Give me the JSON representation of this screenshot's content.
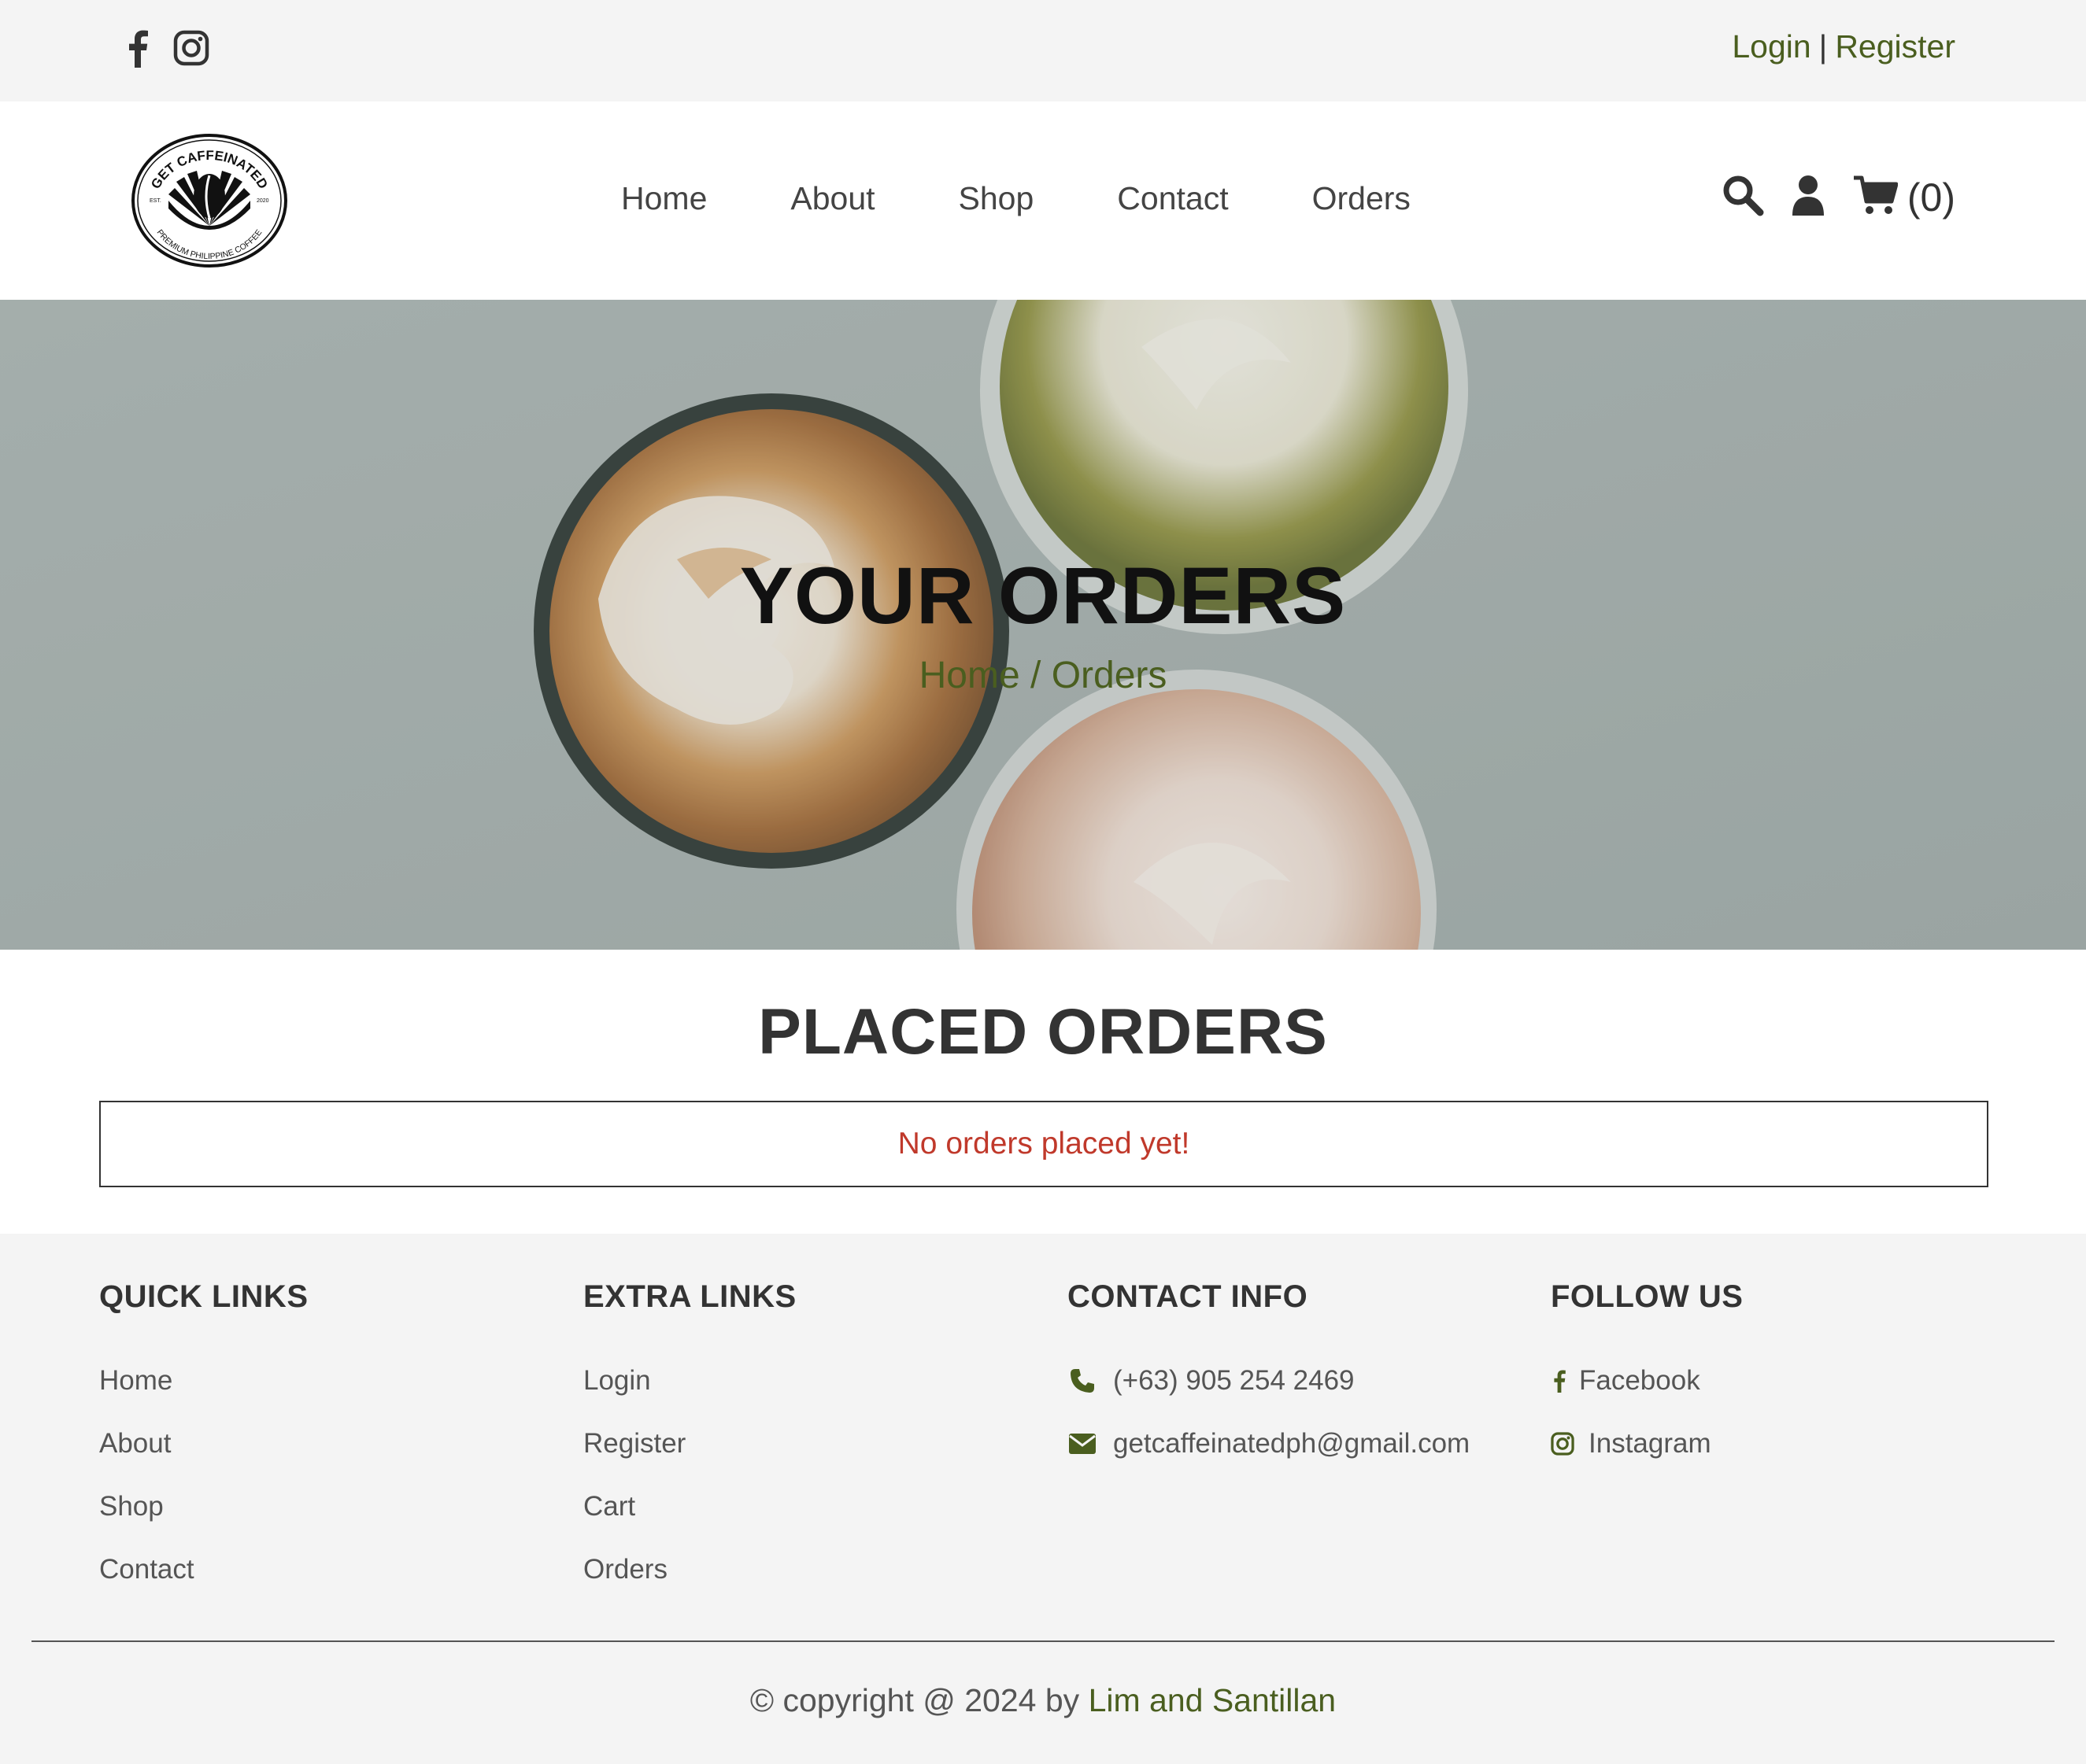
{
  "topbar": {
    "socials": [
      "facebook-icon",
      "instagram-icon"
    ],
    "login": "Login",
    "separator": "|",
    "register": "Register"
  },
  "brand": {
    "logo_top_text": "GET CAFFEINATED",
    "logo_bottom_text": "PREMIUM PHILIPPINE COFFEE",
    "logo_est": "EST.",
    "logo_year": "2020"
  },
  "nav": {
    "items": [
      {
        "label": "Home"
      },
      {
        "label": "About"
      },
      {
        "label": "Shop"
      },
      {
        "label": "Contact"
      },
      {
        "label": "Orders"
      }
    ]
  },
  "tools": {
    "search_icon": "search-icon",
    "user_icon": "user-icon",
    "cart_icon": "cart-icon",
    "cart_count": "(0)"
  },
  "hero": {
    "title": "YOUR ORDERS",
    "crumb_home": "Home",
    "crumb_sep": "/",
    "crumb_current": "Orders"
  },
  "orders": {
    "title": "PLACED ORDERS",
    "empty_message": "No orders placed yet!"
  },
  "footer": {
    "quick_links": {
      "heading": "QUICK LINKS",
      "items": [
        "Home",
        "About",
        "Shop",
        "Contact"
      ]
    },
    "extra_links": {
      "heading": "EXTRA LINKS",
      "items": [
        "Login",
        "Register",
        "Cart",
        "Orders"
      ]
    },
    "contact_info": {
      "heading": "CONTACT INFO",
      "phone": "(+63) 905 254 2469",
      "email": "getcaffeinatedph@gmail.com"
    },
    "follow_us": {
      "heading": "FOLLOW US",
      "facebook": "Facebook",
      "instagram": "Instagram"
    },
    "copyright_prefix": "© copyright @ 2024 by",
    "copyright_authors": "Lim and Santillan"
  },
  "colors": {
    "accent_green": "#4a5e1f",
    "error_red": "#c0392b",
    "bar_gray": "#f4f4f4"
  }
}
